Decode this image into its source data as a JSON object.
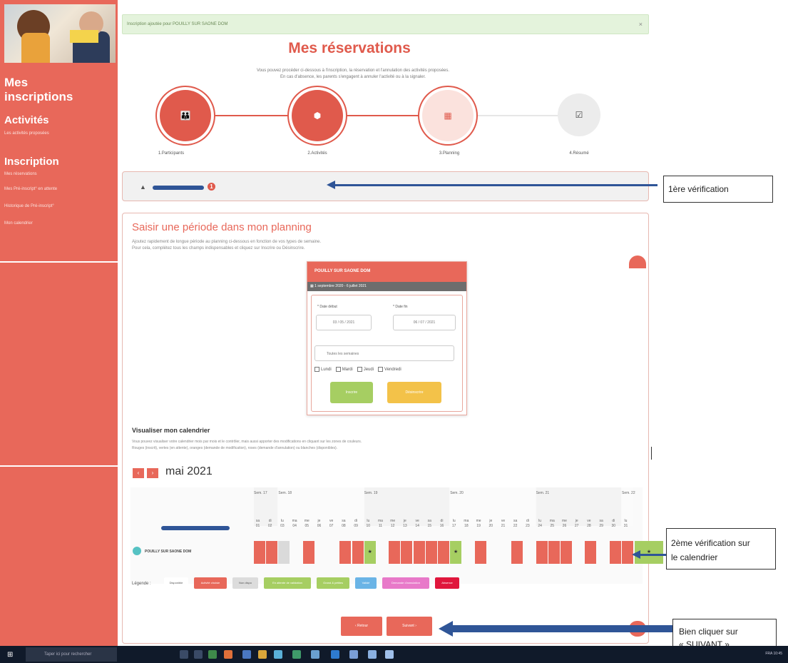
{
  "alert": {
    "text": "Inscription ajoutée pour POUILLY SUR SAONE DOM",
    "close": "×"
  },
  "page_title": "Mes réservations",
  "intro": {
    "line1": "Vous pouvez procéder ci-dessous à l'inscription, la réservation et l'annulation des activités proposées.",
    "line2": "En cas d'absence, les parents s'engagent à annuler l'activité ou à la signaler."
  },
  "steps": [
    {
      "label": "1.Participants",
      "icon": "user-icon",
      "glyph": "👪"
    },
    {
      "label": "2.Activités",
      "icon": "activity-icon",
      "glyph": "⬢"
    },
    {
      "label": "3.Planning",
      "icon": "calendar-icon",
      "glyph": "▦"
    },
    {
      "label": "4.Résumé",
      "icon": "checklist-icon",
      "glyph": "☑"
    }
  ],
  "sidebar": {
    "title_line1": "Mes",
    "title_line2": "inscriptions",
    "section1": "Activités",
    "section1_link": "Les activités proposées",
    "section2": "Inscription",
    "links": [
      "Mes réservations",
      "Mes Pré-inscript° en attente",
      "Historique de Pré-inscript°",
      "Mon calendrier"
    ]
  },
  "participant": {
    "arrow": "▲",
    "badge": "1"
  },
  "saisir": {
    "title": "Saisir une période dans mon planning",
    "desc1": "Ajoutez rapidement de longue période au planning ci-dessous en fonction de vos types de semaine.",
    "desc2": "Pour cela, complétez tous les champs indispensables et cliquez sur Inscrire ou Désinscrire."
  },
  "form": {
    "header": "POUILLY SUR SAONE DOM",
    "period": "▦ 1 septembre 2020 - 6 juillet 2021",
    "date_debut_label": "* Date début",
    "date_fin_label": "* Date fin",
    "date_debut_value": "03 / 05 / 2021",
    "date_fin_value": "06 / 07 / 2021",
    "select_value": "Toutes les semaines",
    "days": [
      "Lundi",
      "Mardi",
      "Jeudi",
      "Vendredi"
    ],
    "btn_inscrire": "Inscrire",
    "btn_desinscrire": "Désinscrire"
  },
  "calendar": {
    "title": "Visualiser mon calendrier",
    "desc1": "Vous pouvez visualiser votre calendrier mois par mois et le contrôler, mais aussi apporter des modifications en cliquant sur les zones de couleurs.",
    "desc2": "Rouges (inscrit), vertes (en attente), oranges (demande de modification), roses (demande d'annulation) ou blanches (disponibles).",
    "prev": "‹",
    "next": "›",
    "month": "mai 2021",
    "weeks": [
      "Sem. 17",
      "Sem. 18",
      "Sem. 19",
      "Sem. 20",
      "Sem. 21",
      "Sem. 22"
    ],
    "days": [
      [
        "sa",
        "01"
      ],
      [
        "di",
        "02"
      ],
      [
        "lu",
        "03"
      ],
      [
        "ma",
        "04"
      ],
      [
        "me",
        "05"
      ],
      [
        "je",
        "06"
      ],
      [
        "ve",
        "07"
      ],
      [
        "sa",
        "08"
      ],
      [
        "di",
        "09"
      ],
      [
        "lu",
        "10"
      ],
      [
        "ma",
        "11"
      ],
      [
        "me",
        "12"
      ],
      [
        "je",
        "13"
      ],
      [
        "ve",
        "14"
      ],
      [
        "sa",
        "15"
      ],
      [
        "di",
        "16"
      ],
      [
        "lu",
        "17"
      ],
      [
        "ma",
        "18"
      ],
      [
        "me",
        "19"
      ],
      [
        "je",
        "20"
      ],
      [
        "ve",
        "21"
      ],
      [
        "sa",
        "22"
      ],
      [
        "di",
        "23"
      ],
      [
        "lu",
        "24"
      ],
      [
        "ma",
        "25"
      ],
      [
        "me",
        "26"
      ],
      [
        "je",
        "27"
      ],
      [
        "ve",
        "28"
      ],
      [
        "sa",
        "29"
      ],
      [
        "di",
        "30"
      ],
      [
        "lu",
        "31"
      ]
    ],
    "row_label": "POUILLY SUR SAONE DOM",
    "legend_title": "Légende :",
    "legend": [
      {
        "label": "Disponible",
        "color": "#ffffff",
        "text": "#555555"
      },
      {
        "label": "Activité choisie",
        "color": "#e8685a",
        "text": "#ffffff"
      },
      {
        "label": "Non dispo",
        "color": "#dcdcdc",
        "text": "#555555"
      },
      {
        "label": "En attente de validation",
        "color": "#a6ce62",
        "text": "#ffffff"
      },
      {
        "label": "Grand & petites",
        "color": "#a6ce62",
        "text": "#ffffff"
      },
      {
        "label": "Validé",
        "color": "#6ab4e6",
        "text": "#ffffff"
      },
      {
        "label": "Demande d'annulation",
        "color": "#e879c9",
        "text": "#ffffff"
      },
      {
        "label": "Absence",
        "color": "#e0163c",
        "text": "#ffffff"
      }
    ]
  },
  "nav": {
    "retour": "‹ Retour",
    "suivant": "Suivant ›"
  },
  "annotations": {
    "first": "1ère vérification",
    "second_line1": "2ème vérification sur",
    "second_line2": "le calendrier",
    "third_line1": "Bien cliquer sur",
    "third_line2": "« SUIVANT »"
  },
  "taskbar": {
    "search": "Taper ici pour rechercher",
    "tray": "FRA 10:45"
  },
  "colors": {
    "brand": "#e8685a",
    "accent_blue": "#2f5597",
    "green": "#a6ce62"
  }
}
